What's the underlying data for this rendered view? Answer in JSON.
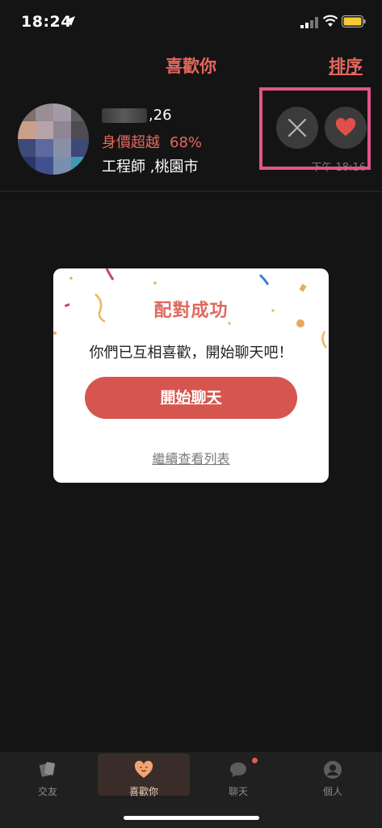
{
  "status_bar": {
    "time": "18:24"
  },
  "header": {
    "title": "喜歡你",
    "sort_label": "排序"
  },
  "list_item": {
    "age": ",26",
    "value_label": "身價超越",
    "value_percent": "68%",
    "job_location": "工程師 ,桃園市",
    "time": "下午 18:16"
  },
  "modal": {
    "title": "配對成功",
    "message": "你們已互相喜歡，開始聊天吧！",
    "start_chat": "開始聊天",
    "continue": "繼續查看列表"
  },
  "tabs": [
    {
      "label": "交友",
      "icon": "cards-icon"
    },
    {
      "label": "喜歡你",
      "icon": "heart-face-icon"
    },
    {
      "label": "聊天",
      "icon": "chat-bubble-icon"
    },
    {
      "label": "個人",
      "icon": "person-icon"
    }
  ],
  "colors": {
    "accent": "#e6675e",
    "button": "#d6564f",
    "highlight": "#e2548a"
  }
}
